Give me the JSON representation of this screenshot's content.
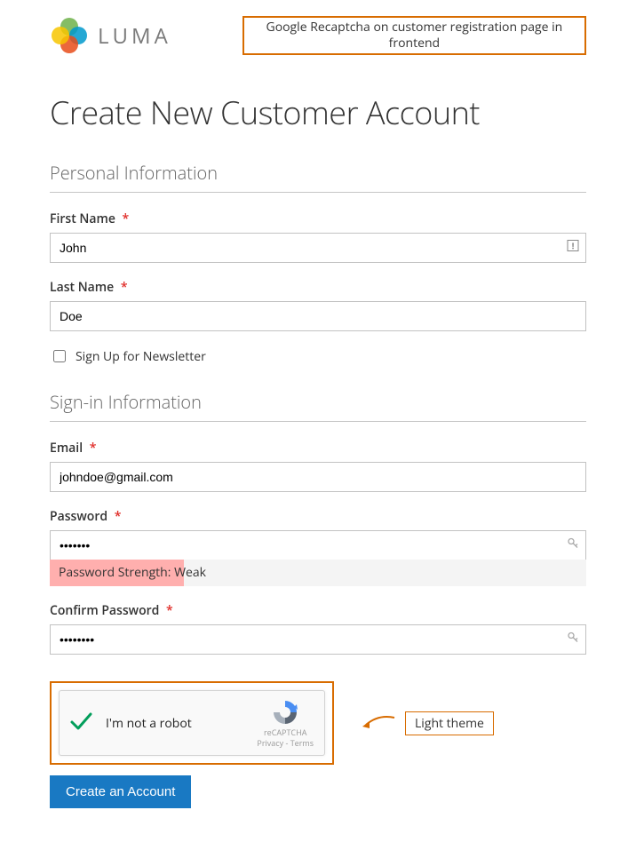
{
  "brand": "LUMA",
  "annotation_top": "Google Recaptcha on customer registration page in frontend",
  "page_title": "Create New Customer Account",
  "sections": {
    "personal": {
      "title": "Personal Information",
      "first_name_label": "First Name",
      "first_name_value": "John",
      "last_name_label": "Last Name",
      "last_name_value": "Doe",
      "newsletter_label": "Sign Up for Newsletter"
    },
    "signin": {
      "title": "Sign-in Information",
      "email_label": "Email",
      "email_value": "johndoe@gmail.com",
      "password_label": "Password",
      "password_value": "•••••••",
      "password_strength_prefix": "Password Strength: ",
      "password_strength_value": "Weak",
      "confirm_label": "Confirm Password",
      "confirm_value": "••••••••"
    }
  },
  "recaptcha": {
    "label": "I'm not a robot",
    "brand": "reCAPTCHA",
    "privacy": "Privacy",
    "terms": "Terms",
    "separator": " - "
  },
  "annotation_side": "Light theme",
  "submit_label": "Create an Account",
  "required_marker": "*"
}
